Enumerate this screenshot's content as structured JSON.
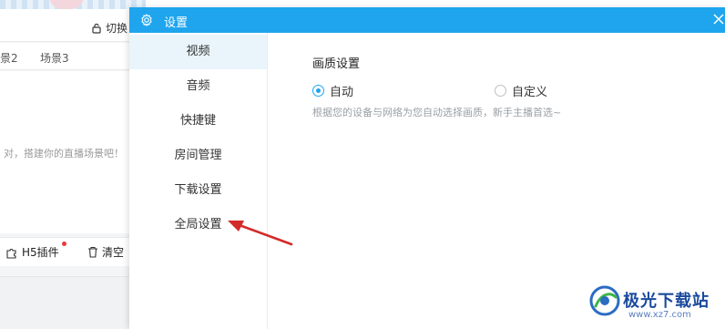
{
  "background_app": {
    "switch_label": "切换",
    "scenes": [
      "景2",
      "场景3"
    ],
    "empty_hint": "对，搭建你的直播场景吧！",
    "toolbar": {
      "h5_label": "H5插件",
      "clear_label": "清空"
    }
  },
  "dialog": {
    "title": "设置",
    "nav": [
      {
        "label": "视频",
        "active": true
      },
      {
        "label": "音频",
        "active": false
      },
      {
        "label": "快捷键",
        "active": false
      },
      {
        "label": "房间管理",
        "active": false
      },
      {
        "label": "下载设置",
        "active": false
      },
      {
        "label": "全局设置",
        "active": false
      }
    ],
    "quality": {
      "title": "画质设置",
      "options": [
        {
          "label": "自动",
          "checked": true
        },
        {
          "label": "自定义",
          "checked": false
        }
      ],
      "hint": "根据您的设备与网络为您自动选择画质，新手主播首选~"
    }
  },
  "watermark": {
    "brand": "极光下载站",
    "url": "www.xz7.com"
  },
  "colors": {
    "titlebar": "#1ea5ee",
    "nav_active_bg": "#eaf4fb",
    "radio_accent": "#1ea5ee",
    "arrow": "#d42a2a"
  }
}
